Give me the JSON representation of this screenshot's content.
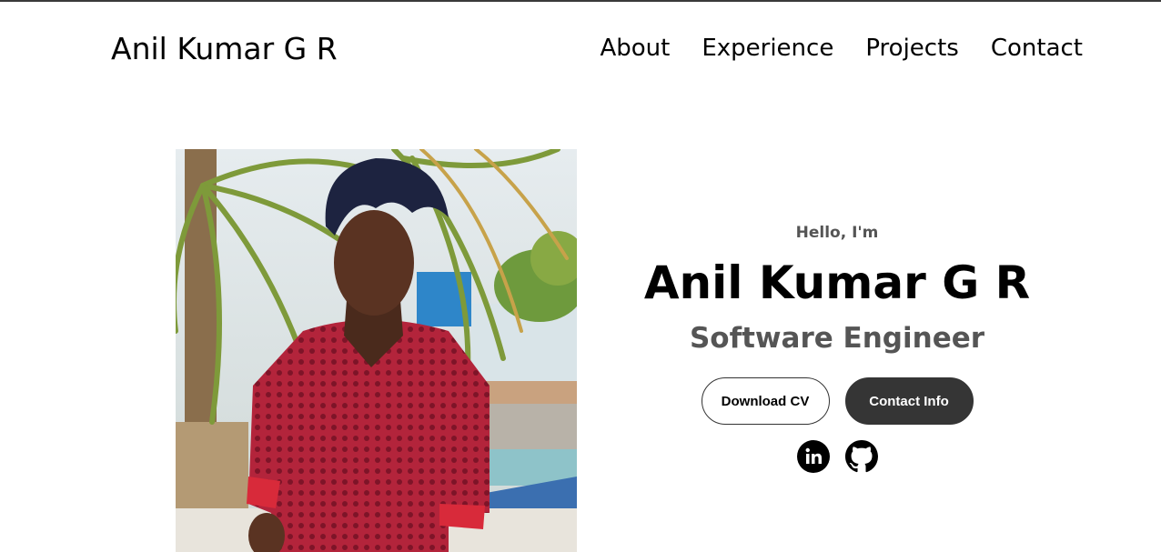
{
  "header": {
    "logo": "Anil Kumar G R",
    "nav": [
      "About",
      "Experience",
      "Projects",
      "Contact"
    ]
  },
  "hero": {
    "greeting": "Hello, I'm",
    "name": "Anil Kumar G R",
    "title": "Software Engineer",
    "buttons": {
      "download_cv": "Download CV",
      "contact_info": "Contact Info"
    },
    "socials": [
      "linkedin-icon",
      "github-icon"
    ]
  },
  "colors": {
    "text": "#000000",
    "muted": "#555555",
    "button_dark": "#353535"
  }
}
